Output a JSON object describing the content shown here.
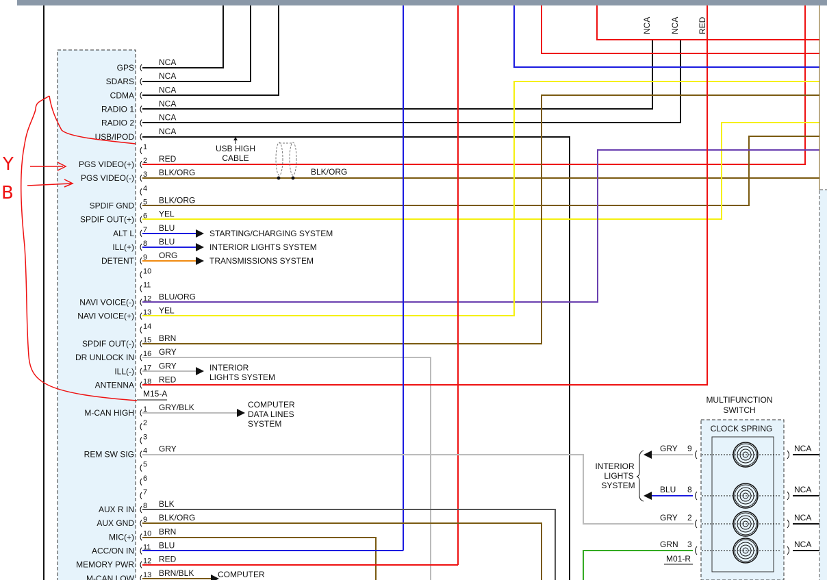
{
  "connector_a": {
    "label": "M15-A",
    "pins": [
      {
        "name": "GPS",
        "pin": "",
        "color": "NCA"
      },
      {
        "name": "SDARS",
        "pin": "",
        "color": "NCA"
      },
      {
        "name": "CDMA",
        "pin": "",
        "color": "NCA"
      },
      {
        "name": "RADIO 1",
        "pin": "",
        "color": "NCA"
      },
      {
        "name": "RADIO 2",
        "pin": "",
        "color": "NCA"
      },
      {
        "name": "USB/IPOD",
        "pin": "",
        "color": "NCA"
      },
      {
        "name": "",
        "pin": "1",
        "color": ""
      },
      {
        "name": "PGS VIDEO(+)",
        "pin": "2",
        "color": "RED"
      },
      {
        "name": "PGS VIDEO(-)",
        "pin": "3",
        "color": "BLK/ORG"
      },
      {
        "name": "",
        "pin": "4",
        "color": ""
      },
      {
        "name": "SPDIF GND",
        "pin": "5",
        "color": "BLK/ORG"
      },
      {
        "name": "SPDIF OUT(+)",
        "pin": "6",
        "color": "YEL"
      },
      {
        "name": "ALT L",
        "pin": "7",
        "color": "BLU"
      },
      {
        "name": "ILL(+)",
        "pin": "8",
        "color": "BLU"
      },
      {
        "name": "DETENT",
        "pin": "9",
        "color": "ORG"
      },
      {
        "name": "",
        "pin": "10",
        "color": ""
      },
      {
        "name": "",
        "pin": "11",
        "color": ""
      },
      {
        "name": "NAVI VOICE(-)",
        "pin": "12",
        "color": "BLU/ORG"
      },
      {
        "name": "NAVI VOICE(+)",
        "pin": "13",
        "color": "YEL"
      },
      {
        "name": "",
        "pin": "14",
        "color": ""
      },
      {
        "name": "SPDIF OUT(-)",
        "pin": "15",
        "color": "BRN"
      },
      {
        "name": "DR UNLOCK IN",
        "pin": "16",
        "color": "GRY"
      },
      {
        "name": "ILL(-)",
        "pin": "17",
        "color": "GRY"
      },
      {
        "name": "ANTENNA",
        "pin": "18",
        "color": "RED"
      }
    ]
  },
  "connector_b": {
    "pins": [
      {
        "name": "M-CAN HIGH",
        "pin": "1",
        "color": "GRY/BLK"
      },
      {
        "name": "",
        "pin": "2",
        "color": ""
      },
      {
        "name": "",
        "pin": "3",
        "color": ""
      },
      {
        "name": "REM SW SIG",
        "pin": "4",
        "color": "GRY"
      },
      {
        "name": "",
        "pin": "5",
        "color": ""
      },
      {
        "name": "",
        "pin": "6",
        "color": ""
      },
      {
        "name": "",
        "pin": "7",
        "color": ""
      },
      {
        "name": "AUX R IN",
        "pin": "8",
        "color": "BLK"
      },
      {
        "name": "AUX GND",
        "pin": "9",
        "color": "BLK/ORG"
      },
      {
        "name": "MIC(+)",
        "pin": "10",
        "color": "BRN"
      },
      {
        "name": "ACC/ON IN",
        "pin": "11",
        "color": "BLU"
      },
      {
        "name": "MEMORY PWR",
        "pin": "12",
        "color": "RED"
      },
      {
        "name": "M-CAN LOW",
        "pin": "13",
        "color": "BRN/BLK"
      }
    ]
  },
  "cable": {
    "line1": "USB HIGH",
    "line2": "CABLE",
    "shield_color": "BLK/ORG"
  },
  "destinations": {
    "starting": "STARTING/CHARGING SYSTEM",
    "interior": "INTERIOR LIGHTS SYSTEM",
    "transmission": "TRANSMISSIONS SYSTEM",
    "interior2_l1": "INTERIOR",
    "interior2_l2": "LIGHTS SYSTEM",
    "computer_l1": "COMPUTER",
    "computer_l2": "DATA LINES",
    "computer_l3": "SYSTEM",
    "computer2": "COMPUTER"
  },
  "top_labels": [
    "NCA",
    "NCA",
    "RED"
  ],
  "multifunction": {
    "title_l1": "MULTIFUNCTION",
    "title_l2": "SWITCH",
    "clock_spring": "CLOCK SPRING",
    "connector": "M01-R",
    "interior_l1": "INTERIOR",
    "interior_l2": "LIGHTS",
    "interior_l3": "SYSTEM",
    "pins": [
      {
        "color": "GRY",
        "pin": "9",
        "out": "NCA"
      },
      {
        "color": "BLU",
        "pin": "8",
        "out": "NCA"
      },
      {
        "color": "GRY",
        "pin": "2",
        "out": "NCA"
      },
      {
        "color": "GRN",
        "pin": "3",
        "out": "NCA"
      }
    ]
  },
  "annotations": {
    "y": "Y",
    "b": "B"
  },
  "wire_colors": {
    "red": "#ee1111",
    "blue": "#1a1ae0",
    "yellow": "#f5f010",
    "brown": "#7a5a10",
    "orange": "#f08a10",
    "gray": "#bbbbbb",
    "green": "#33aa22",
    "black": "#111111",
    "purple": "#6a40b0",
    "module_fill": "#e6f3fb",
    "annotation": "#ee1111"
  }
}
